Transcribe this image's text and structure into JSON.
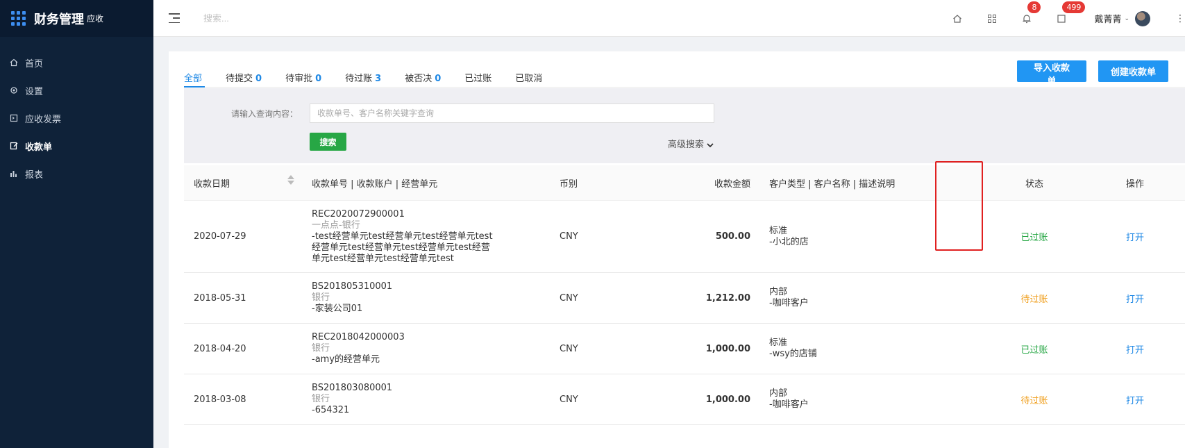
{
  "brand": {
    "title": "财务管理",
    "subtitle": "应收"
  },
  "sidebar": {
    "items": [
      {
        "label": "首页",
        "icon": "home-icon"
      },
      {
        "label": "设置",
        "icon": "gear-icon"
      },
      {
        "label": "应收发票",
        "icon": "invoice-icon"
      },
      {
        "label": "收款单",
        "icon": "receipt-icon",
        "active": true
      },
      {
        "label": "报表",
        "icon": "chart-icon"
      }
    ]
  },
  "header": {
    "search_placeholder": "搜索...",
    "bell_badge": "8",
    "message_badge": "499",
    "user_name": "戴菁菁"
  },
  "tabs": [
    {
      "label": "全部",
      "count": ""
    },
    {
      "label": "待提交",
      "count": "0"
    },
    {
      "label": "待审批",
      "count": "0"
    },
    {
      "label": "待过账",
      "count": "3"
    },
    {
      "label": "被否决",
      "count": "0"
    },
    {
      "label": "已过账",
      "count": ""
    },
    {
      "label": "已取消",
      "count": ""
    }
  ],
  "actions": {
    "import_label": "导入收款单",
    "create_label": "创建收款单"
  },
  "filter": {
    "label": "请输入查询内容：",
    "placeholder": "收款单号、客户名称关键字查询",
    "search_label": "搜索",
    "advanced_label": "高级搜索"
  },
  "table": {
    "headers": {
      "date": "收款日期",
      "no": "收款单号 | 收款账户 | 经营单元",
      "currency": "币别",
      "amount": "收款金额",
      "customer": "客户类型 | 客户名称 | 描述说明",
      "status": "状态",
      "op": "操作"
    },
    "rows": [
      {
        "date": "2020-07-29",
        "no": "REC2020072900001",
        "account": "一点点-银行",
        "unit_lines": [
          "-test经营单元test经营单元test经营单元test",
          "经营单元test经营单元test经营单元test经营",
          "单元test经营单元test经营单元test"
        ],
        "currency": "CNY",
        "amount": "500.00",
        "cust_type": "标准",
        "cust_name": "-小北的店",
        "status": "已过账",
        "status_kind": "ok",
        "op": "打开"
      },
      {
        "date": "2018-05-31",
        "no": "BS201805310001",
        "account": "银行",
        "unit_lines": [
          "-家装公司01"
        ],
        "currency": "CNY",
        "amount": "1,212.00",
        "cust_type": "内部",
        "cust_name": "-咖啡客户",
        "status": "待过账",
        "status_kind": "wait",
        "op": "打开"
      },
      {
        "date": "2018-04-20",
        "no": "REC2018042000003",
        "account": "银行",
        "unit_lines": [
          "-amy的经营单元"
        ],
        "currency": "CNY",
        "amount": "1,000.00",
        "cust_type": "标准",
        "cust_name": "-wsy的店铺",
        "status": "已过账",
        "status_kind": "ok",
        "op": "打开"
      },
      {
        "date": "2018-03-08",
        "no": "BS201803080001",
        "account": "银行",
        "unit_lines": [
          "-654321"
        ],
        "currency": "CNY",
        "amount": "1,000.00",
        "cust_type": "内部",
        "cust_name": "-咖啡客户",
        "status": "待过账",
        "status_kind": "wait",
        "op": "打开"
      }
    ]
  },
  "colors": {
    "sidebar_bg": "#0f2239",
    "accent": "#2196f3",
    "success": "#27a745",
    "warning": "#f0a020",
    "highlight": "#e02020"
  }
}
